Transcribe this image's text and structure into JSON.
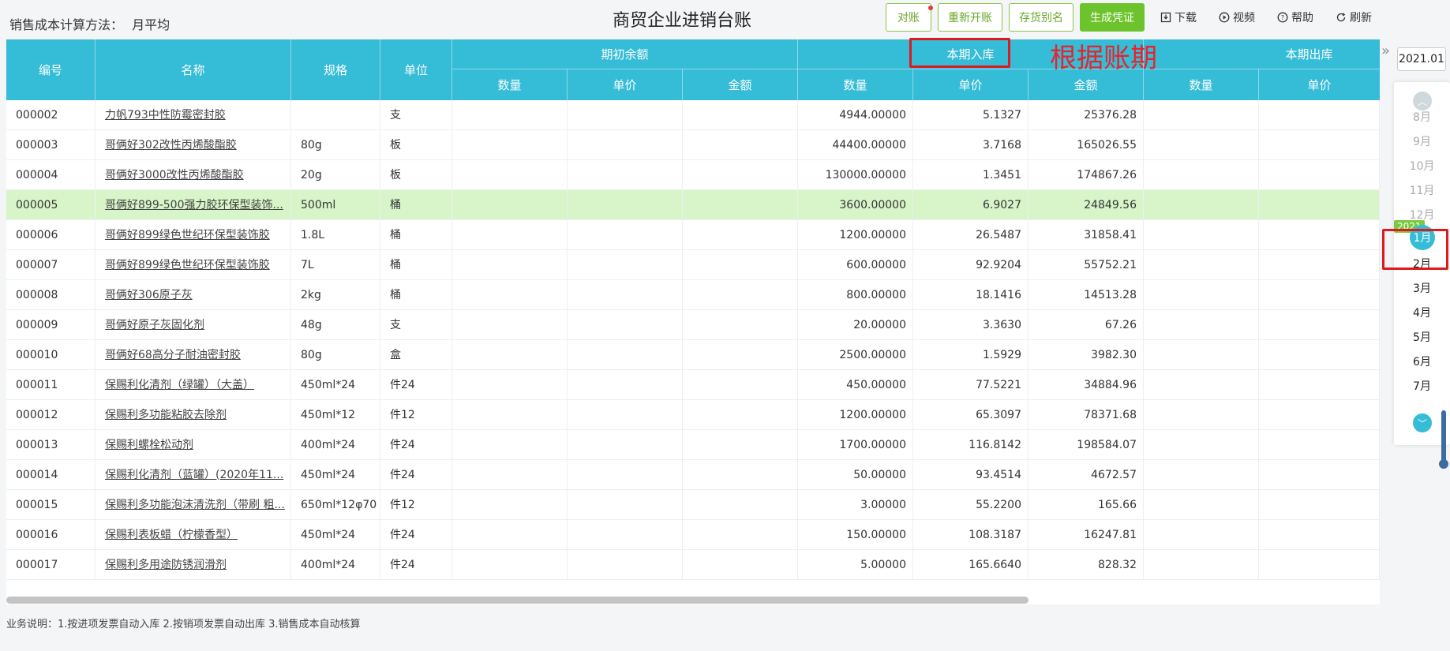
{
  "method": {
    "label": "销售成本计算方法：",
    "value": "月平均"
  },
  "title": "商贸企业进销台账",
  "buttons": {
    "reconcile": "对账",
    "reopen": "重新开账",
    "alias": "存货别名",
    "voucher": "生成凭证"
  },
  "tools": {
    "download": "下载",
    "video": "视频",
    "help": "帮助",
    "refresh": "刷新"
  },
  "table": {
    "headers": {
      "code": "编号",
      "name": "名称",
      "spec": "规格",
      "unit": "单位",
      "opening": "期初余额",
      "inbound": "本期入库",
      "outbound": "本期出库",
      "qty": "数量",
      "price": "单价",
      "amount": "金额"
    },
    "rows": [
      {
        "code": "000002",
        "name": "力帆793中性防霉密封胶",
        "spec": "",
        "unit": "支",
        "in_qty": "4944.00000",
        "in_price": "5.1327",
        "in_amount": "25376.28"
      },
      {
        "code": "000003",
        "name": "哥俩好302改性丙烯酸酯胶",
        "spec": "80g",
        "unit": "板",
        "in_qty": "44400.00000",
        "in_price": "3.7168",
        "in_amount": "165026.55"
      },
      {
        "code": "000004",
        "name": "哥俩好3000改性丙烯酸酯胶",
        "spec": "20g",
        "unit": "板",
        "in_qty": "130000.00000",
        "in_price": "1.3451",
        "in_amount": "174867.26"
      },
      {
        "code": "000005",
        "name": "哥俩好899-500强力胶环保型装饰...",
        "spec": "500ml",
        "unit": "桶",
        "in_qty": "3600.00000",
        "in_price": "6.9027",
        "in_amount": "24849.56"
      },
      {
        "code": "000006",
        "name": "哥俩好899绿色世纪环保型装饰胶",
        "spec": "1.8L",
        "unit": "桶",
        "in_qty": "1200.00000",
        "in_price": "26.5487",
        "in_amount": "31858.41"
      },
      {
        "code": "000007",
        "name": "哥俩好899绿色世纪环保型装饰胶",
        "spec": "7L",
        "unit": "桶",
        "in_qty": "600.00000",
        "in_price": "92.9204",
        "in_amount": "55752.21"
      },
      {
        "code": "000008",
        "name": "哥俩好306原子灰",
        "spec": "2kg",
        "unit": "桶",
        "in_qty": "800.00000",
        "in_price": "18.1416",
        "in_amount": "14513.28"
      },
      {
        "code": "000009",
        "name": "哥俩好原子灰固化剂",
        "spec": "48g",
        "unit": "支",
        "in_qty": "20.00000",
        "in_price": "3.3630",
        "in_amount": "67.26"
      },
      {
        "code": "000010",
        "name": "哥俩好68高分子耐油密封胶",
        "spec": "80g",
        "unit": "盒",
        "in_qty": "2500.00000",
        "in_price": "1.5929",
        "in_amount": "3982.30"
      },
      {
        "code": "000011",
        "name": "保赐利化清剂（绿罐）（大盖）",
        "spec": "450ml*24",
        "unit": "件24",
        "in_qty": "450.00000",
        "in_price": "77.5221",
        "in_amount": "34884.96"
      },
      {
        "code": "000012",
        "name": "保赐利多功能粘胶去除剂",
        "spec": "450ml*12",
        "unit": "件12",
        "in_qty": "1200.00000",
        "in_price": "65.3097",
        "in_amount": "78371.68"
      },
      {
        "code": "000013",
        "name": "保赐利螺栓松动剂",
        "spec": "400ml*24",
        "unit": "件24",
        "in_qty": "1700.00000",
        "in_price": "116.8142",
        "in_amount": "198584.07"
      },
      {
        "code": "000014",
        "name": "保赐利化清剂（蓝罐）(2020年11...",
        "spec": "450ml*24",
        "unit": "件24",
        "in_qty": "50.00000",
        "in_price": "93.4514",
        "in_amount": "4672.57"
      },
      {
        "code": "000015",
        "name": "保赐利多功能泡沫清洗剂（带刷 粗...",
        "spec": "650ml*12φ70",
        "unit": "件12",
        "in_qty": "3.00000",
        "in_price": "55.2200",
        "in_amount": "165.66"
      },
      {
        "code": "000016",
        "name": "保赐利表板蜡（柠檬香型）",
        "spec": "450ml*24",
        "unit": "件24",
        "in_qty": "150.00000",
        "in_price": "108.3187",
        "in_amount": "16247.81"
      },
      {
        "code": "000017",
        "name": "保赐利多用途防锈润滑剂",
        "spec": "400ml*24",
        "unit": "件24",
        "in_qty": "5.00000",
        "in_price": "165.6640",
        "in_amount": "828.32"
      }
    ],
    "highlight_row": 3
  },
  "annotation": "根据账期",
  "footer": "业务说明：1.按进项发票自动入库   2.按销项发票自动出库   3.销售成本自动核算",
  "period": {
    "current": "2021.01",
    "year_badge": "2021",
    "months": [
      "8月",
      "9月",
      "10月",
      "11月",
      "12月",
      "1月",
      "2月",
      "3月",
      "4月",
      "5月",
      "6月",
      "7月"
    ],
    "active_index": 5
  },
  "colors": {
    "header": "#35bcd6",
    "highlight": "#d7f5c8",
    "primary_button": "#6cc32b",
    "annotation": "#e0191e"
  }
}
